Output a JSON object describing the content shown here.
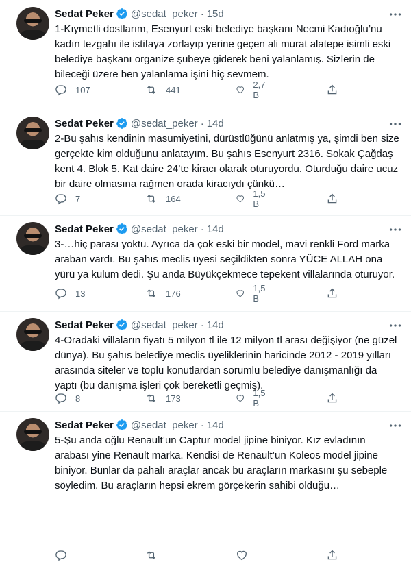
{
  "account": {
    "name": "Sedat Peker",
    "handle": "@sedat_peker"
  },
  "separator": "·",
  "tweets": [
    {
      "time": "15d",
      "text": "1-Kıymetli dostlarım, Esenyurt eski belediye başkanı Necmi Kadıoğlu’nu kadın tezgahı ile istifaya zorlayıp yerine geçen ali murat alatepe isimli eski belediye başkanı organize şubeye giderek beni yalanlamış. Sizlerin de bileceği üzere ben yalanlama işini hiç sevmem.",
      "replies": "107",
      "retweets": "441",
      "likes": "2,7 B"
    },
    {
      "time": "14d",
      "text": "2-Bu şahıs kendinin masumiyetini, dürüstlüğünü anlatmış ya, şimdi ben size gerçekte kim olduğunu anlatayım. Bu şahıs Esenyurt 2316. Sokak Çağdaş kent 4. Blok 5. Kat daire 24’te kiracı olarak oturuyordu. Oturduğu daire ucuz bir daire olmasına rağmen orada kiracıydı çünkü…",
      "replies": "7",
      "retweets": "164",
      "likes": "1,5 B"
    },
    {
      "time": "14d",
      "text": "3-…hiç parası yoktu. Ayrıca da çok eski bir model, mavi renkli Ford marka araban vardı. Bu şahıs meclis üyesi seçildikten sonra YÜCE ALLAH ona yürü ya kulum dedi. Şu anda Büyükçekmece tepekent villalarında oturuyor.",
      "replies": "13",
      "retweets": "176",
      "likes": "1,5 B"
    },
    {
      "time": "14d",
      "text": "4-Oradaki villaların fiyatı 5 milyon tl ile 12 milyon tl arası değişiyor (ne güzel dünya). Bu şahıs belediye meclis üyeliklerinin haricinde 2012 - 2019 yılları arasında siteler ve toplu konutlardan sorumlu belediye danışmanlığı da yaptı (bu danışma işleri çok bereketli geçmiş).",
      "replies": "8",
      "retweets": "173",
      "likes": "1,5 B"
    },
    {
      "time": "14d",
      "text": "5-Şu anda oğlu Renault’un Captur model jipine biniyor. Kız evladının arabası yine Renault marka. Kendisi de Renault’un Koleos model jipine biniyor. Bunlar da pahalı araçlar ancak bu araçların markasını şu sebeple söyledim. Bu araçların hepsi ekrem görçekerin sahibi olduğu…",
      "replies": "",
      "retweets": "",
      "likes": ""
    }
  ],
  "colors": {
    "text": "#0f1419",
    "muted": "#536471",
    "verified": "#1d9bf0",
    "divider": "#eff3f4"
  },
  "icons": [
    "verified-badge-icon",
    "more-icon",
    "reply-icon",
    "retweet-icon",
    "like-icon",
    "share-icon"
  ]
}
